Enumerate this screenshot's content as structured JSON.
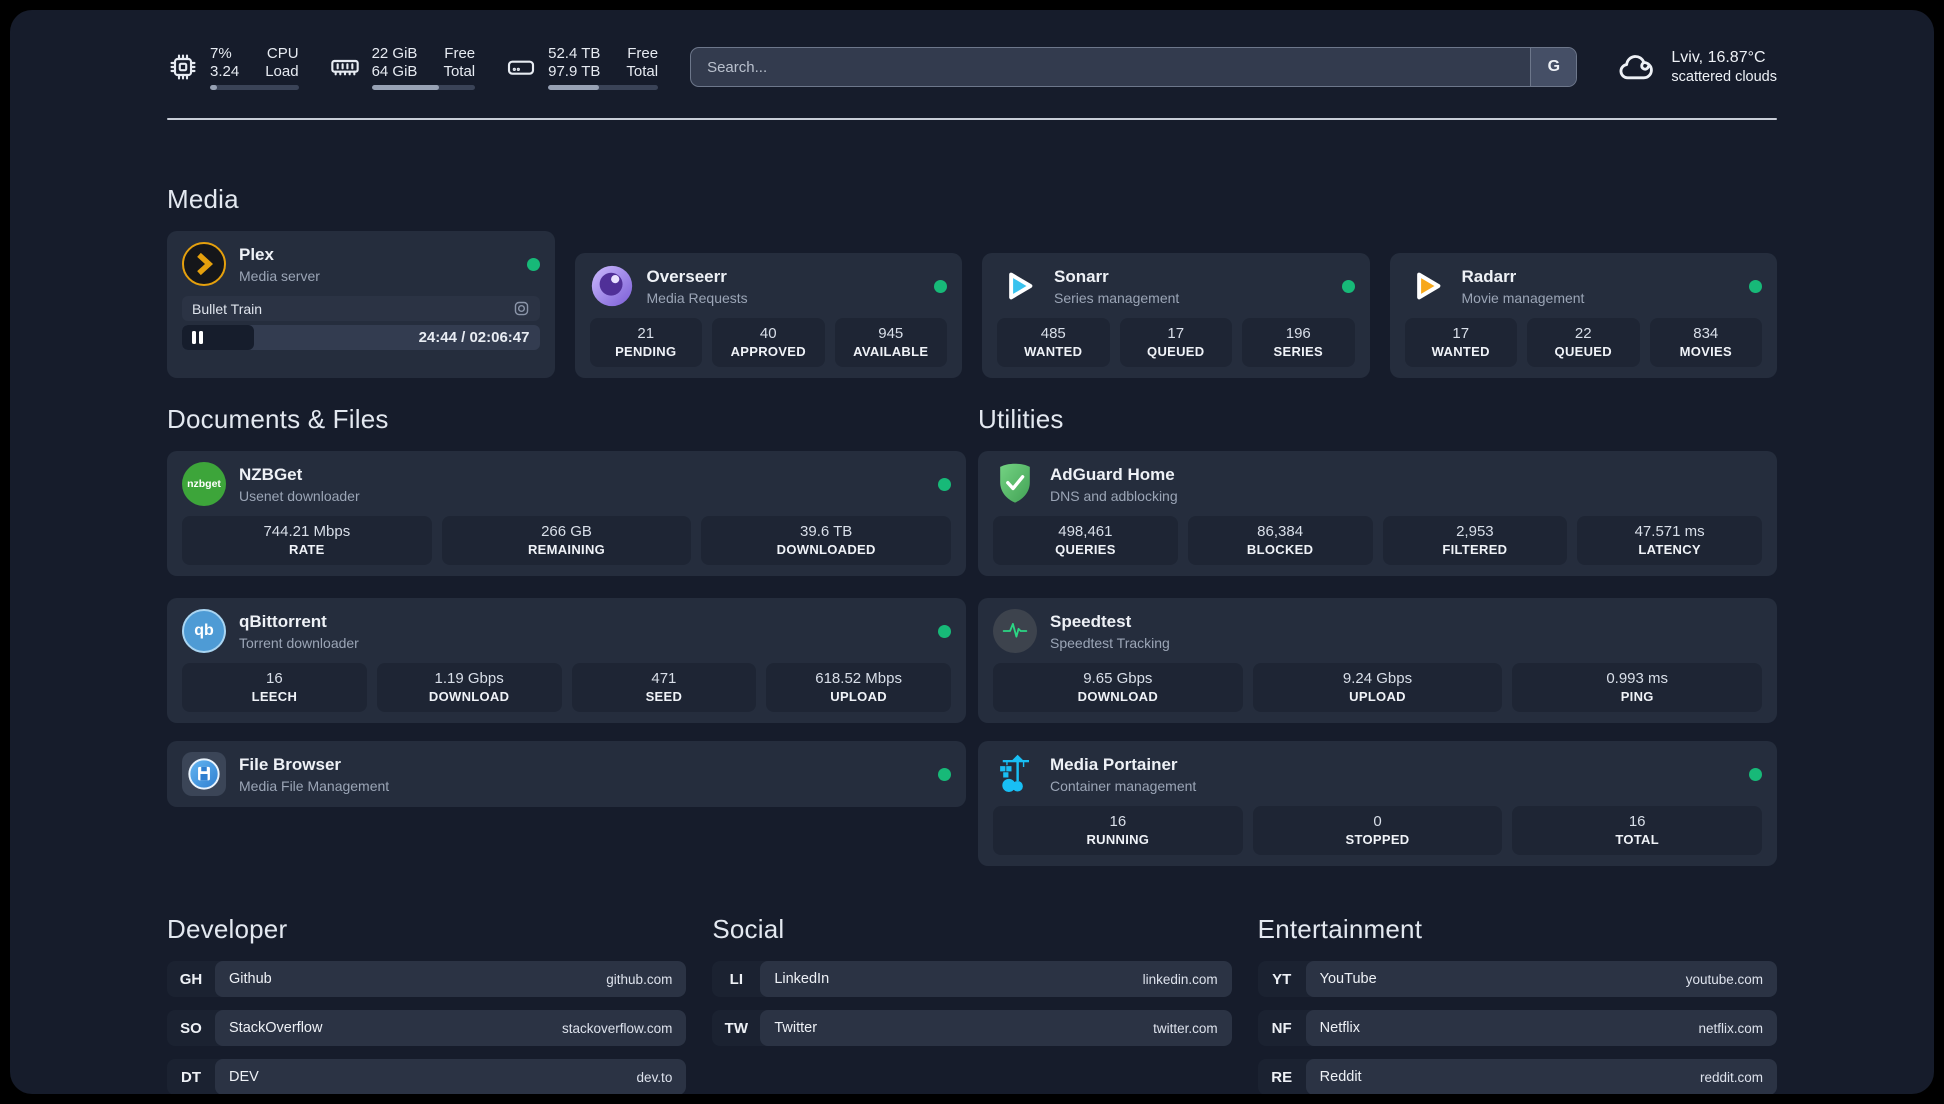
{
  "colors": {
    "online_dot": "#17b978",
    "plex_amber": "#e5a00d",
    "sonarr_blue": "#38c2ee",
    "radarr_orange": "#f7a81b",
    "portainer_cyan": "#18bff5",
    "adguard_green": "#57bd68",
    "speedtest_green": "#2bd784",
    "nzbget_green": "#3da53a",
    "qbittorrent_blue": "#4e9bd5",
    "overseerr_purple": "#7b5dd6"
  },
  "header": {
    "stats": [
      {
        "name": "cpu",
        "values": [
          "7%",
          "3.24"
        ],
        "labels": [
          "CPU",
          "Load"
        ],
        "progress": "8%"
      },
      {
        "name": "memory",
        "values": [
          "22 GiB",
          "64 GiB"
        ],
        "labels": [
          "Free",
          "Total"
        ],
        "progress": "65%"
      },
      {
        "name": "storage",
        "values": [
          "52.4 TB",
          "97.9 TB"
        ],
        "labels": [
          "Free",
          "Total"
        ],
        "progress": "46%"
      }
    ],
    "search": {
      "placeholder": "Search...",
      "engine_button": "G"
    },
    "weather": {
      "location": "Lviv, 16.87°C",
      "condition": "scattered clouds"
    }
  },
  "media": {
    "title": "Media",
    "plex": {
      "name": "Plex",
      "subtitle": "Media server",
      "now_playing": "Bullet Train",
      "time": "24:44 / 02:06:47",
      "progress": "20%"
    },
    "overseerr": {
      "name": "Overseerr",
      "subtitle": "Media Requests",
      "stats": [
        {
          "value": "21",
          "label": "PENDING"
        },
        {
          "value": "40",
          "label": "APPROVED"
        },
        {
          "value": "945",
          "label": "AVAILABLE"
        }
      ]
    },
    "sonarr": {
      "name": "Sonarr",
      "subtitle": "Series management",
      "stats": [
        {
          "value": "485",
          "label": "WANTED"
        },
        {
          "value": "17",
          "label": "QUEUED"
        },
        {
          "value": "196",
          "label": "SERIES"
        }
      ]
    },
    "radarr": {
      "name": "Radarr",
      "subtitle": "Movie management",
      "stats": [
        {
          "value": "17",
          "label": "WANTED"
        },
        {
          "value": "22",
          "label": "QUEUED"
        },
        {
          "value": "834",
          "label": "MOVIES"
        }
      ]
    }
  },
  "documents": {
    "title": "Documents & Files",
    "nzbget": {
      "name": "NZBGet",
      "subtitle": "Usenet downloader",
      "icon_text": "nzbget",
      "stats": [
        {
          "value": "744.21 Mbps",
          "label": "RATE"
        },
        {
          "value": "266 GB",
          "label": "REMAINING"
        },
        {
          "value": "39.6 TB",
          "label": "DOWNLOADED"
        }
      ]
    },
    "qbittorrent": {
      "name": "qBittorrent",
      "subtitle": "Torrent downloader",
      "icon_text": "qb",
      "stats": [
        {
          "value": "16",
          "label": "LEECH"
        },
        {
          "value": "1.19 Gbps",
          "label": "DOWNLOAD"
        },
        {
          "value": "471",
          "label": "SEED"
        },
        {
          "value": "618.52 Mbps",
          "label": "UPLOAD"
        }
      ]
    },
    "filebrowser": {
      "name": "File Browser",
      "subtitle": "Media File Management"
    }
  },
  "utilities": {
    "title": "Utilities",
    "adguard": {
      "name": "AdGuard Home",
      "subtitle": "DNS and adblocking",
      "stats": [
        {
          "value": "498,461",
          "label": "QUERIES"
        },
        {
          "value": "86,384",
          "label": "BLOCKED"
        },
        {
          "value": "2,953",
          "label": "FILTERED"
        },
        {
          "value": "47.571 ms",
          "label": "LATENCY"
        }
      ]
    },
    "speedtest": {
      "name": "Speedtest",
      "subtitle": "Speedtest Tracking",
      "stats": [
        {
          "value": "9.65 Gbps",
          "label": "DOWNLOAD"
        },
        {
          "value": "9.24 Gbps",
          "label": "UPLOAD"
        },
        {
          "value": "0.993 ms",
          "label": "PING"
        }
      ]
    },
    "portainer": {
      "name": "Media Portainer",
      "subtitle": "Container management",
      "stats": [
        {
          "value": "16",
          "label": "RUNNING"
        },
        {
          "value": "0",
          "label": "STOPPED"
        },
        {
          "value": "16",
          "label": "TOTAL"
        }
      ]
    }
  },
  "bookmarks": [
    {
      "title": "Developer",
      "links": [
        {
          "abbr": "GH",
          "name": "Github",
          "url": "github.com"
        },
        {
          "abbr": "SO",
          "name": "StackOverflow",
          "url": "stackoverflow.com"
        },
        {
          "abbr": "DT",
          "name": "DEV",
          "url": "dev.to"
        }
      ]
    },
    {
      "title": "Social",
      "links": [
        {
          "abbr": "LI",
          "name": "LinkedIn",
          "url": "linkedin.com"
        },
        {
          "abbr": "TW",
          "name": "Twitter",
          "url": "twitter.com"
        }
      ]
    },
    {
      "title": "Entertainment",
      "links": [
        {
          "abbr": "YT",
          "name": "YouTube",
          "url": "youtube.com"
        },
        {
          "abbr": "NF",
          "name": "Netflix",
          "url": "netflix.com"
        },
        {
          "abbr": "RE",
          "name": "Reddit",
          "url": "reddit.com"
        }
      ]
    }
  ]
}
